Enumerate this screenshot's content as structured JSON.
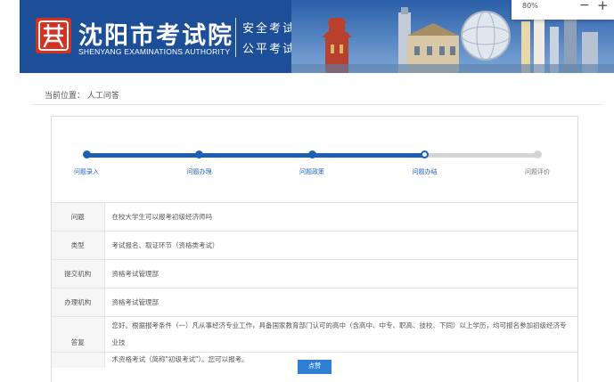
{
  "header": {
    "title": "沈阳市考试院",
    "subtitle": "SHENYANG EXAMINATIONS AUTHORITY",
    "slogan_1": "安全考试",
    "slogan_2": "公平考试",
    "colors": {
      "banner": "#1c4f97",
      "logo": "#d7301f"
    }
  },
  "zoom": {
    "value": "80%",
    "minus": "−",
    "plus": "+"
  },
  "breadcrumb": {
    "text": "当前位置： 人工问答"
  },
  "progress": {
    "steps": [
      {
        "label": "问题录入",
        "state": "done"
      },
      {
        "label": "问题办理",
        "state": "done"
      },
      {
        "label": "问题政策",
        "state": "done"
      },
      {
        "label": "问题办结",
        "state": "current"
      },
      {
        "label": "问题评价",
        "state": "pending"
      }
    ],
    "completed_fraction": 0.75,
    "accent": "#1c5fb5"
  },
  "detail": {
    "question_label": "问题",
    "question": "在校大学生可以报考初级经济师吗",
    "type_label": "类型",
    "type": "考试报名、取证环节（资格类考试）",
    "submit_org_label": "提交机构",
    "submit_org": "资格考试管理部",
    "handle_org_label": "办理机构",
    "handle_org": "资格考试管理部",
    "answer_label": "答复",
    "answer_line_1": "您好。根据报考条件（一）凡从事经济专业工作，具备国家教育部门认可的高中（含高中、中专、职高、技校、下同）以上学历，均可报名参加初级经济专业技",
    "answer_line_2": "术资格考试（简称\"初级考试\"）。您可以报考。"
  },
  "actions": {
    "like_label": "点赞"
  }
}
